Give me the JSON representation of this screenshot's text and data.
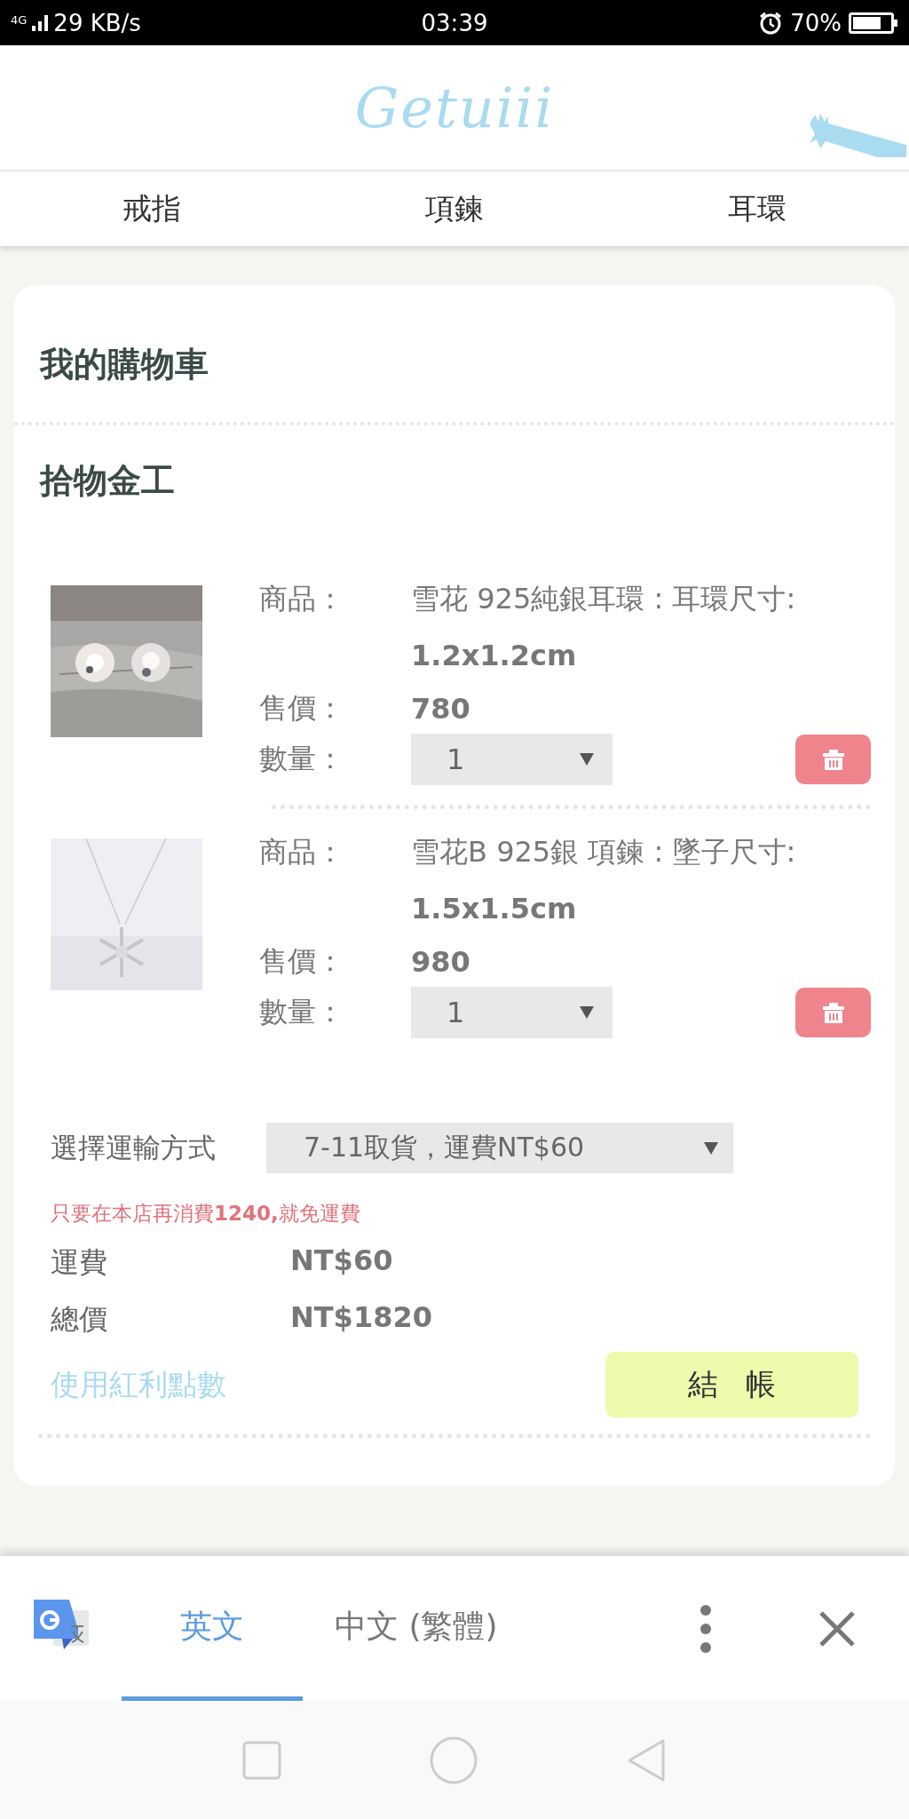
{
  "status_bar": {
    "network": "4G",
    "speed": "29 KB/s",
    "time": "03:39",
    "battery": "70%"
  },
  "header": {
    "logo": "Getuiii"
  },
  "categories": [
    {
      "label": "戒指"
    },
    {
      "label": "項鍊"
    },
    {
      "label": "耳環"
    }
  ],
  "cart": {
    "title": "我的購物車",
    "shop": "拾物金工",
    "items": [
      {
        "product_label": "商品：",
        "product": "雪花 925純銀耳環 : 耳環尺寸:",
        "size": "1.2x1.2cm",
        "price_label": "售價：",
        "price": "780",
        "qty_label": "數量：",
        "qty": "1"
      },
      {
        "product_label": "商品：",
        "product": "雪花B 925銀 項鍊 : 墜子尺寸:",
        "size": "1.5x1.5cm",
        "price_label": "售價：",
        "price": "980",
        "qty_label": "數量：",
        "qty": "1"
      }
    ],
    "shipping": {
      "label": "選擇運輸方式",
      "value": "7-11取貨，運費NT$60"
    },
    "notice": "只要在本店再消費**1240,**就免運費",
    "summary": [
      {
        "label": "運費",
        "value": "NT$60"
      },
      {
        "label": "總價",
        "value": "NT$1820"
      }
    ],
    "bonus_link": "使用紅利點數",
    "checkout": "結 帳"
  },
  "translate_bar": {
    "tabs": [
      {
        "label": "英文",
        "selected": true
      },
      {
        "label": "中文 (繁體)",
        "selected": false
      }
    ]
  }
}
